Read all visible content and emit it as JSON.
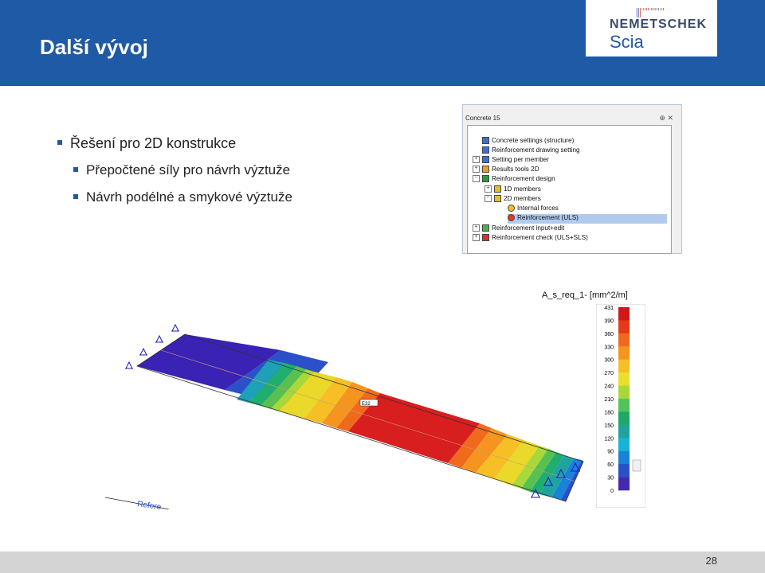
{
  "header": {
    "title": "Další vývoj"
  },
  "logo": {
    "name": "NEMETSCHEK",
    "sub": "Scia"
  },
  "bullets": {
    "main": "Řešení pro 2D konstrukce",
    "sub1": "Přepočtené síly pro návrh výztuže",
    "sub2": "Návrh podélné a smykové výztuže"
  },
  "panel": {
    "title": "Concrete 15",
    "controls": "⊕ ✕",
    "items": [
      "Concrete settings (structure)",
      "Reinforcement drawing setting",
      "Setting per member",
      "Results tools 2D",
      "Reinforcement design",
      "1D members",
      "2D members",
      "Internal forces",
      "Reinforcement (ULS)",
      "Reinforcement input+edit",
      "Reinforcement check (ULS+SLS)"
    ]
  },
  "legend": {
    "title": "A_s_req_1- [mm^2/m]",
    "ticks": [
      "431",
      "390",
      "360",
      "330",
      "300",
      "270",
      "240",
      "210",
      "180",
      "150",
      "120",
      "90",
      "60",
      "30",
      "0"
    ],
    "colors": [
      "#d01818",
      "#e53a1a",
      "#f06a1e",
      "#f5951f",
      "#f7bf26",
      "#e8e02c",
      "#a8d83a",
      "#52c35a",
      "#1fa868",
      "#1ea3a0",
      "#18b4d6",
      "#1a82d8",
      "#2850c8",
      "#4628b0"
    ]
  },
  "model": {
    "reference_text": "Refere",
    "member_label": "E32"
  },
  "footer": {
    "page": "28"
  }
}
